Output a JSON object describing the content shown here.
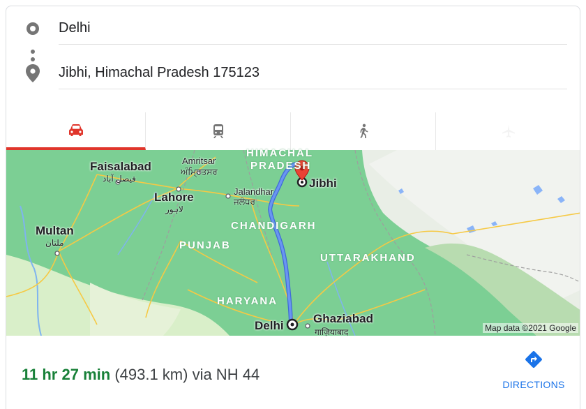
{
  "route": {
    "origin": "Delhi",
    "destination": "Jibhi, Himachal Pradesh 175123"
  },
  "tabs": [
    {
      "icon": "car-icon",
      "active": true
    },
    {
      "icon": "train-icon",
      "active": false
    },
    {
      "icon": "walk-icon",
      "active": false
    },
    {
      "icon": "flight-icon",
      "active": false
    }
  ],
  "map": {
    "regions": {
      "himachal_line1": "HIMACHAL",
      "himachal_line2": "PRADESH",
      "chandigarh": "CHANDIGARH",
      "punjab": "PUNJAB",
      "uttarakhand": "UTTARAKHAND",
      "haryana": "HARYANA"
    },
    "cities": {
      "faisalabad": "Faisalabad",
      "faisalabad_local": "فیصل آباد",
      "amritsar": "Amritsar",
      "amritsar_local": "ਅੰਮ੍ਰਿਤਸਰ",
      "lahore": "Lahore",
      "lahore_local": "لاہور",
      "jalandhar": "Jalandhar",
      "jalandhar_local": "ਜਲੰਧਰ",
      "multan": "Multan",
      "multan_local": "ملتان",
      "jibhi": "Jibhi",
      "delhi": "Delhi",
      "ghaziabad": "Ghaziabad",
      "ghaziabad_local": "गाज़ियाबाद"
    },
    "attribution": "Map data ©2021 Google"
  },
  "summary": {
    "duration": "11 hr 27 min",
    "details": "(493.1 km) via NH 44"
  },
  "directions_label": "DIRECTIONS",
  "colors": {
    "accent_red": "#e0352b",
    "duration_green": "#188038",
    "link_blue": "#1a73e8",
    "route_blue": "#4a7ee8"
  }
}
